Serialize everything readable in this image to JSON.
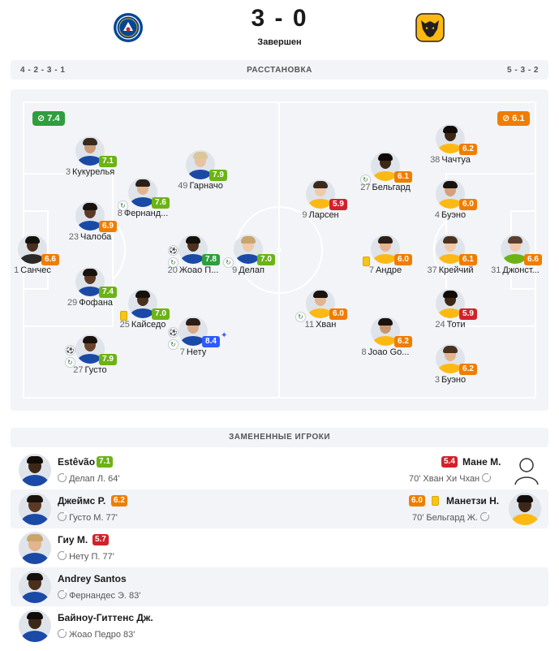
{
  "match": {
    "home_logo_icon": "chelsea-crest-icon",
    "away_logo_icon": "wolves-crest-icon",
    "score": "3 - 0",
    "status": "Завершен"
  },
  "formation": {
    "home": "4 - 2 - 3 - 1",
    "title": "РАССТАНОВКА",
    "away": "5 - 3 - 2"
  },
  "team_ratings": {
    "home": "7.4",
    "away": "6.1"
  },
  "colors": {
    "green": "#6cb314",
    "dark_green": "#2e9e3e",
    "orange": "#f07d00",
    "red": "#d1222c",
    "blue": "#2d5bff",
    "pitch_bg": "#f2f4f7",
    "pitch_line": "#ffffff"
  },
  "home_players": [
    {
      "num": "3",
      "name": "Кукурелья",
      "rating": "7.1",
      "color": "green"
    },
    {
      "num": "49",
      "name": "Гарначо",
      "rating": "7.9",
      "color": "green"
    },
    {
      "num": "8",
      "name": "Фернанд...",
      "rating": "7.6",
      "color": "green"
    },
    {
      "num": "23",
      "name": "Чалоба",
      "rating": "6.9",
      "color": "orange"
    },
    {
      "num": "1",
      "name": "Санчес",
      "rating": "6.6",
      "color": "orange"
    },
    {
      "num": "20",
      "name": "Жоао П...",
      "rating": "7.8",
      "color": "dark_green"
    },
    {
      "num": "9",
      "name": "Делап",
      "rating": "7.0",
      "color": "green"
    },
    {
      "num": "29",
      "name": "Фофана",
      "rating": "7.4",
      "color": "green"
    },
    {
      "num": "25",
      "name": "Кайседо",
      "rating": "7.0",
      "color": "green"
    },
    {
      "num": "7",
      "name": "Нету",
      "rating": "8.4",
      "color": "blue"
    },
    {
      "num": "27",
      "name": "Густо",
      "rating": "7.9",
      "color": "green"
    }
  ],
  "away_players": [
    {
      "num": "38",
      "name": "Чачтуа",
      "rating": "6.2",
      "color": "orange"
    },
    {
      "num": "27",
      "name": "Бельгард",
      "rating": "6.1",
      "color": "orange"
    },
    {
      "num": "9",
      "name": "Ларсен",
      "rating": "5.9",
      "color": "red"
    },
    {
      "num": "4",
      "name": "Буэно",
      "rating": "6.0",
      "color": "orange"
    },
    {
      "num": "7",
      "name": "Андре",
      "rating": "6.0",
      "color": "orange"
    },
    {
      "num": "37",
      "name": "Крейчий",
      "rating": "6.1",
      "color": "orange"
    },
    {
      "num": "31",
      "name": "Джонст...",
      "rating": "6.6",
      "color": "orange"
    },
    {
      "num": "11",
      "name": "Хван",
      "rating": "6.0",
      "color": "orange"
    },
    {
      "num": "24",
      "name": "Тоти",
      "rating": "5.9",
      "color": "red"
    },
    {
      "num": "8",
      "name": "Joao Go...",
      "rating": "6.2",
      "color": "orange"
    },
    {
      "num": "3",
      "name": "Буэно",
      "rating": "6.2",
      "color": "orange"
    }
  ],
  "subs": {
    "title": "ЗАМЕНЕННЫЕ ИГРОКИ",
    "rows": [
      {
        "home_name": "Estêvão",
        "home_rating": "7.1",
        "home_color": "green",
        "home_off": "Делап Л. 64'",
        "away_name": "Мане М.",
        "away_rating": "5.4",
        "away_color": "red",
        "away_off": "70' Хван Хи Чхан"
      },
      {
        "home_name": "Джеймс Р.",
        "home_rating": "6.2",
        "home_color": "orange",
        "home_off": "Густо М. 77'",
        "away_name": "Манетзи Н.",
        "away_rating": "6.0",
        "away_color": "orange",
        "away_off": "70' Бельгард Ж."
      },
      {
        "home_name": "Гиу М.",
        "home_rating": "5.7",
        "home_color": "red",
        "home_off": "Нету П. 77'"
      },
      {
        "home_name": "Andrey Santos",
        "home_off": "Фернандес Э. 83'"
      },
      {
        "home_name": "Байноу-Гиттенс Дж.",
        "home_off": "Жоао Педро 83'"
      }
    ]
  }
}
